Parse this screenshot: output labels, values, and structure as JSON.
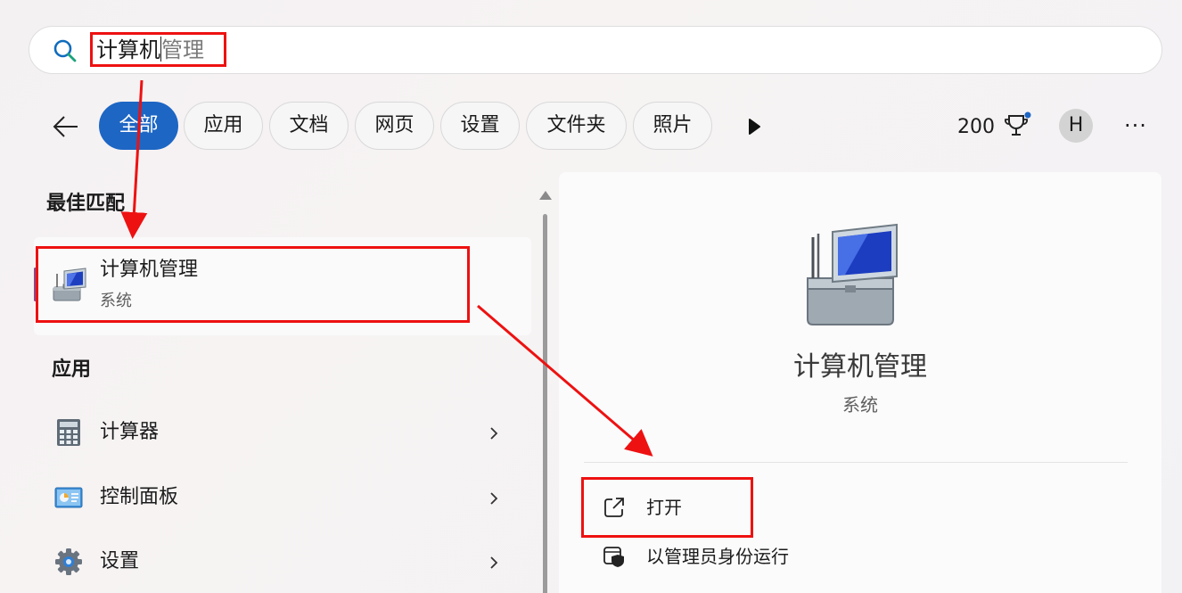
{
  "search": {
    "typed": "计算机",
    "suggestion": "管理"
  },
  "filters": {
    "tabs": [
      "全部",
      "应用",
      "文档",
      "网页",
      "设置",
      "文件夹",
      "照片"
    ],
    "active": "全部"
  },
  "rewards": {
    "points": "200"
  },
  "account": {
    "initial": "H"
  },
  "more": {
    "label": "···"
  },
  "results": {
    "best_match_heading": "最佳匹配",
    "best_match": {
      "title": "计算机管理",
      "subtitle": "系统"
    },
    "apps_heading": "应用",
    "apps": [
      {
        "label": "计算器",
        "icon": "calculator-icon"
      },
      {
        "label": "控制面板",
        "icon": "control-panel-icon"
      },
      {
        "label": "设置",
        "icon": "settings-gear-icon"
      }
    ]
  },
  "detail": {
    "title": "计算机管理",
    "subtitle": "系统",
    "actions": [
      {
        "label": "打开",
        "icon": "open-external-icon"
      },
      {
        "label": "以管理员身份运行",
        "icon": "admin-shield-icon"
      }
    ]
  },
  "colors": {
    "accent": "#1d66c4",
    "annotation": "#ee1111"
  }
}
